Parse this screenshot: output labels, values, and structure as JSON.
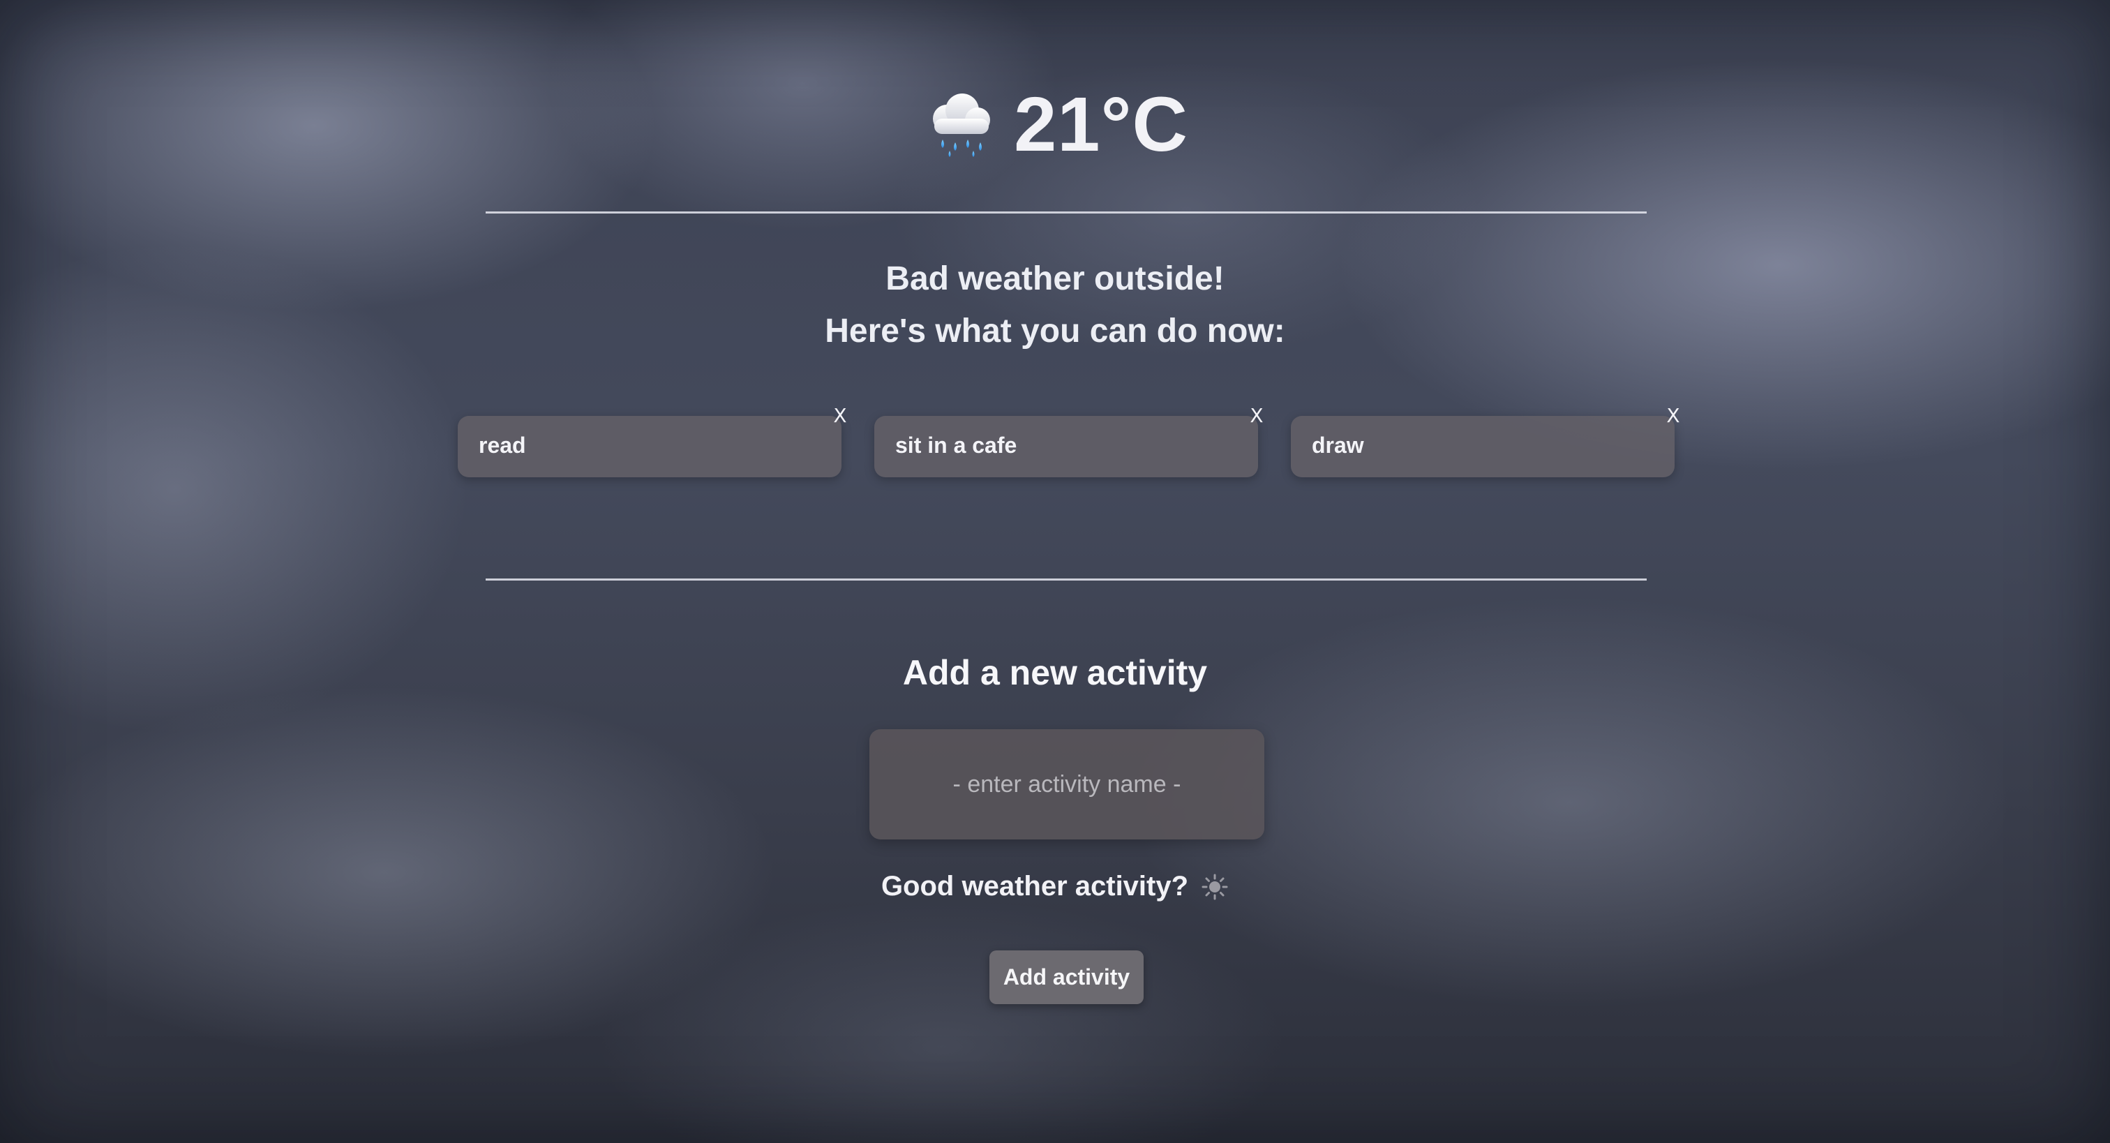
{
  "weather": {
    "icon": "rain-cloud-icon",
    "temperature": "21°C"
  },
  "message": {
    "line1": "Bad weather outside!",
    "line2": "Here's what you can do now:"
  },
  "activities": [
    {
      "label": "read",
      "remove_label": "X"
    },
    {
      "label": "sit in a cafe",
      "remove_label": "X"
    },
    {
      "label": "draw",
      "remove_label": "X"
    }
  ],
  "form": {
    "title": "Add a new activity",
    "input_placeholder": "- enter activity name -",
    "input_value": "",
    "good_weather_label": "Good weather activity?",
    "good_weather_icon": "sun-icon",
    "good_weather_checked": false,
    "submit_label": "Add activity"
  },
  "colors": {
    "card_background": "#646068",
    "button_background": "#6c6a70",
    "text": "#f0f0f4"
  }
}
